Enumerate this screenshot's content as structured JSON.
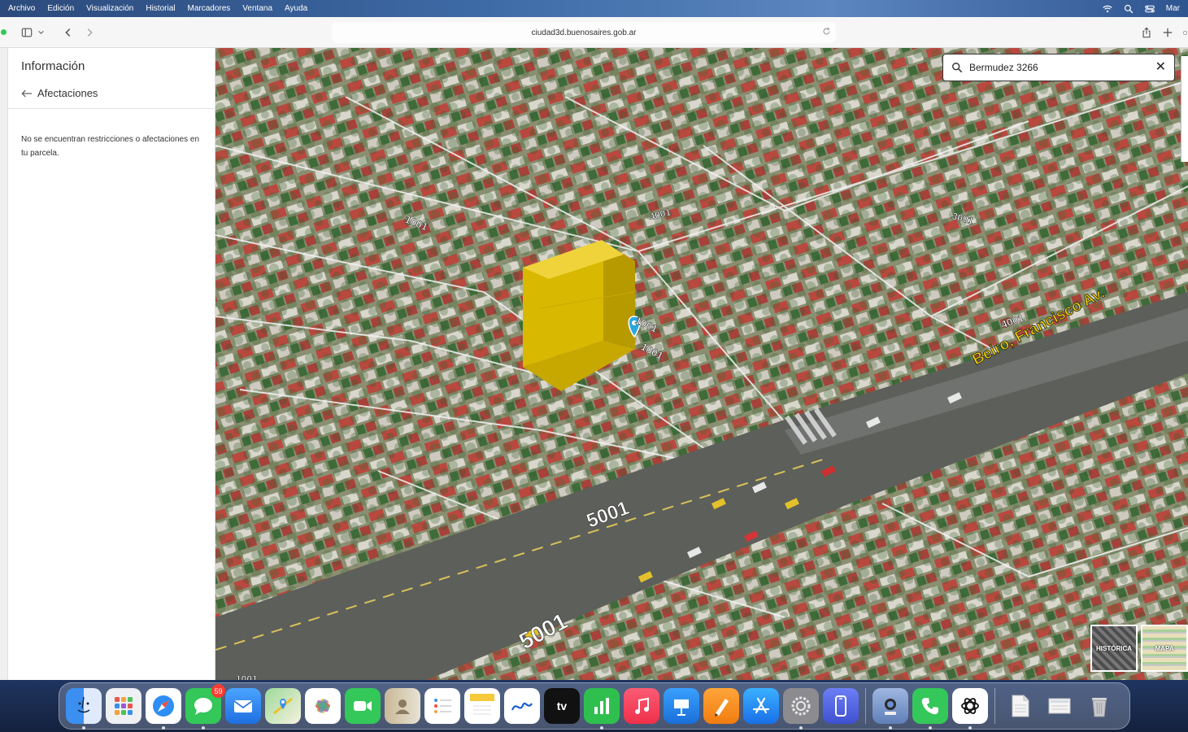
{
  "menubar": {
    "items": [
      "Archivo",
      "Edición",
      "Visualización",
      "Historial",
      "Marcadores",
      "Ventana",
      "Ayuda"
    ],
    "clock": "Mar"
  },
  "browser": {
    "url": "ciudad3d.buenosaires.gob.ar"
  },
  "sidebar": {
    "title": "Información",
    "back_label": "Afectaciones",
    "message": "No se encuentran restricciones o afectaciones en tu parcela."
  },
  "map": {
    "search_value": "Bermudez 3266",
    "street_label": "Beiro, Francisco Av.",
    "number_labels": [
      "5001",
      "5001",
      "1001",
      "1001",
      "4001",
      "3001",
      "1001",
      "1001",
      "4001"
    ],
    "layer_historica": "HISTÓRICA",
    "layer_mapa": "MAPA",
    "colors": {
      "building": "#e5c300",
      "marker": "#29a8e0"
    }
  },
  "dock": {
    "messages_badge": "59",
    "apps": [
      "finder-icon",
      "launchpad-icon",
      "safari-icon",
      "messages-icon",
      "mail-icon",
      "maps-icon",
      "photos-icon",
      "facetime-icon",
      "contacts-icon",
      "reminders-icon",
      "notes-icon",
      "freeform-icon",
      "tv-icon",
      "numbers-icon",
      "music-icon",
      "keynote-icon",
      "pages-icon",
      "app-store-icon",
      "system-settings-icon",
      "iphone-mirroring-icon",
      "preview-icon",
      "phone-icon",
      "chatgpt-icon",
      "document-icon",
      "screenshot-icon",
      "trash-icon"
    ],
    "tv_label": "tv"
  }
}
